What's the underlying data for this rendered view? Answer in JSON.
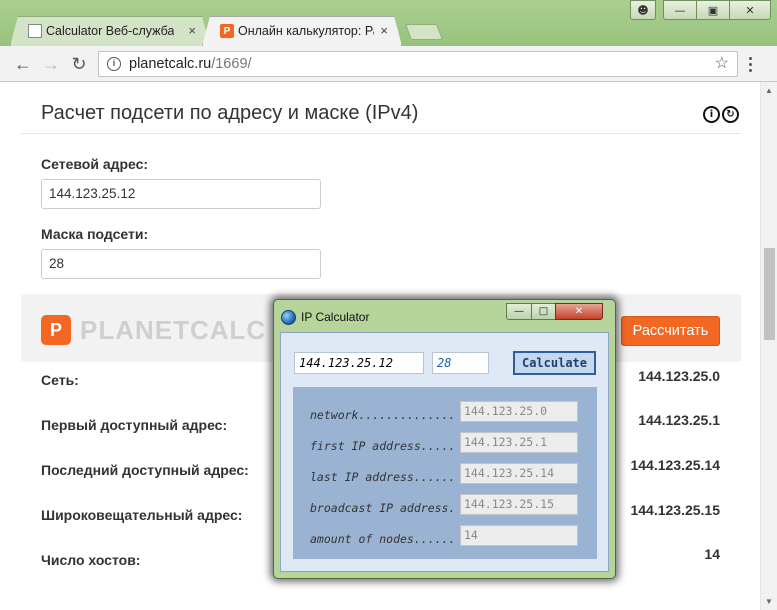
{
  "browser": {
    "tabs": [
      {
        "label": "Calculator Веб-служба",
        "active": false
      },
      {
        "label": "Онлайн калькулятор: Ра",
        "active": true
      }
    ],
    "url_host": "planetcalc.ru",
    "url_path": "/1669/",
    "close_glyph": "×"
  },
  "calculator": {
    "title": "Расчет подсети по адресу и маске (IPv4)",
    "network_label": "Сетевой адрес:",
    "network_value": "144.123.25.12",
    "mask_label": "Маска подсети:",
    "mask_value": "28",
    "brand": "PLANETCALC",
    "calculate_label": "Рассчитать",
    "results": [
      {
        "label": "Сеть:",
        "value": "144.123.25.0"
      },
      {
        "label": "Первый доступный адрес:",
        "value": "144.123.25.1"
      },
      {
        "label": "Последний доступный адрес:",
        "value": "144.123.25.14"
      },
      {
        "label": "Широковещательный адрес:",
        "value": "144.123.25.15"
      },
      {
        "label": "Число хостов:",
        "value": "14"
      }
    ]
  },
  "ip_window": {
    "title": "IP Calculator",
    "address": "144.123.25.12",
    "mask": "28",
    "calculate_label": "Calculate",
    "rows": [
      {
        "label": "network..............",
        "value": "144.123.25.0"
      },
      {
        "label": "first IP address.....",
        "value": "144.123.25.1"
      },
      {
        "label": "last IP address......",
        "value": "144.123.25.14"
      },
      {
        "label": "broadcast IP address.",
        "value": "144.123.25.15"
      },
      {
        "label": "amount of nodes......",
        "value": "14"
      }
    ]
  },
  "colors": {
    "accent_orange": "#f26822",
    "window_frame_green": "#b5d59b"
  }
}
